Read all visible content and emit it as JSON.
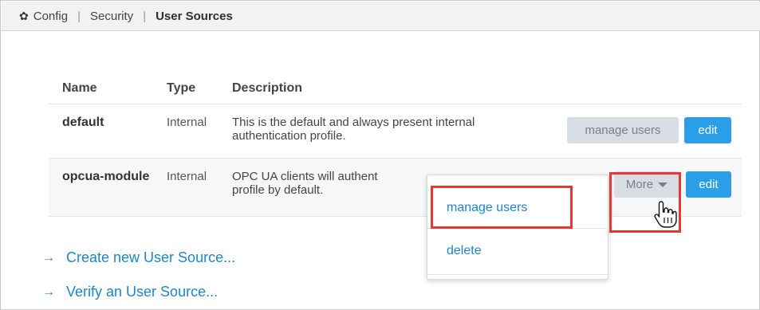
{
  "breadcrumb": {
    "items": [
      "Config",
      "Security"
    ],
    "current": "User Sources"
  },
  "table": {
    "headers": {
      "name": "Name",
      "type": "Type",
      "description": "Description"
    },
    "rows": [
      {
        "name": "default",
        "type": "Internal",
        "description": "This is the default and always present internal authentication profile.",
        "actions": {
          "manage": "manage users",
          "edit": "edit"
        }
      },
      {
        "name": "opcua-module",
        "type": "Internal",
        "description": "OPC UA clients will authent",
        "description_line2": "profile by default.",
        "actions": {
          "more": "More",
          "edit": "edit"
        }
      }
    ]
  },
  "dropdown": {
    "items": [
      "manage users",
      "delete"
    ]
  },
  "links": {
    "create": "Create new User Source...",
    "verify": "Verify an User Source..."
  },
  "colors": {
    "accent": "#2a9ee6",
    "link": "#1e86c8",
    "highlight": "#e53935"
  }
}
